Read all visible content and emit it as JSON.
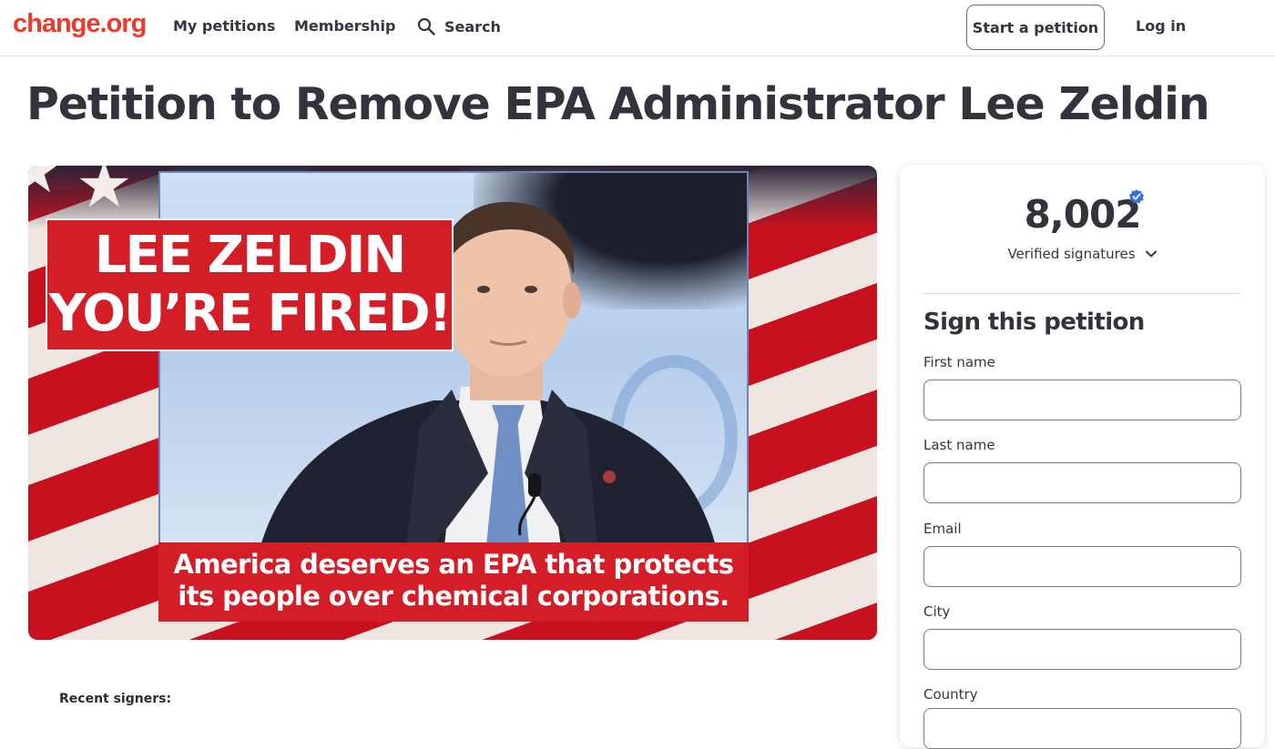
{
  "header": {
    "logo": "change.org",
    "nav": {
      "my_petitions": "My petitions",
      "membership": "Membership",
      "search": "Search"
    },
    "start_petition": "Start a petition",
    "login": "Log in"
  },
  "petition": {
    "title": "Petition to Remove EPA Administrator Lee Zeldin",
    "image": {
      "headline_line1": "LEE ZELDIN",
      "headline_line2": "YOU’RE FIRED!",
      "caption_line1": "America deserves an EPA that protects",
      "caption_line2": "its people over chemical corporations."
    },
    "recent_signers_label": "Recent signers:"
  },
  "sign_card": {
    "signature_count": "8,002",
    "verified_label": "Verified signatures",
    "heading": "Sign this petition",
    "fields": {
      "first_name": {
        "label": "First name",
        "value": ""
      },
      "last_name": {
        "label": "Last name",
        "value": ""
      },
      "email": {
        "label": "Email",
        "value": ""
      },
      "city": {
        "label": "City",
        "value": ""
      },
      "country": {
        "label": "Country",
        "value": ""
      }
    }
  },
  "colors": {
    "brand": "#ed3a2b",
    "banner_red": "#d41e27",
    "verified_blue": "#3a6fe0",
    "text_dark": "#34333d"
  },
  "icons": [
    "search-icon",
    "verified-badge-icon",
    "chevron-down-icon"
  ]
}
